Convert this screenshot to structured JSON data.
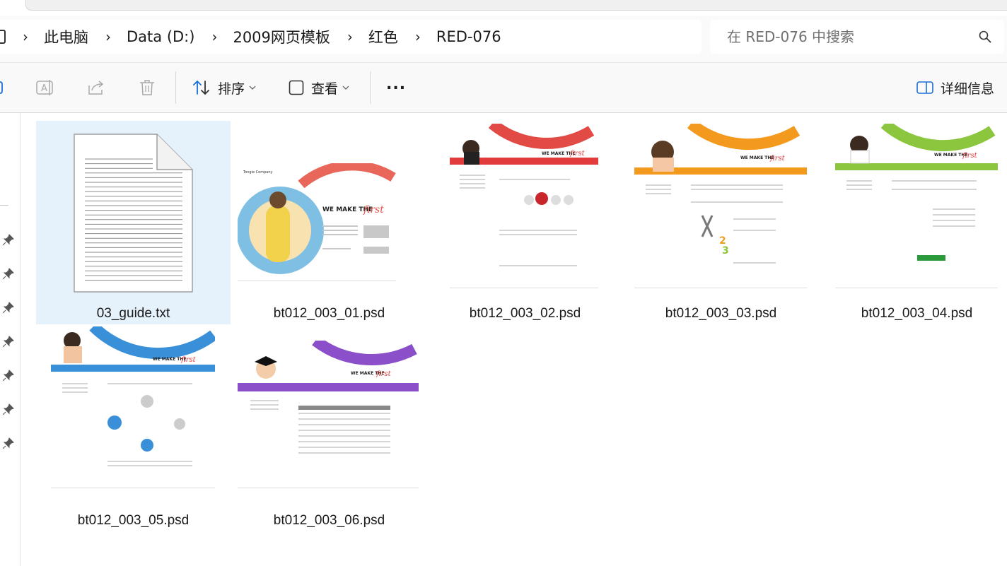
{
  "address_bar": {
    "breadcrumbs": [
      "此电脑",
      "Data (D:)",
      "2009网页模板",
      "红色",
      "RED-076"
    ]
  },
  "search": {
    "placeholder": "在 RED-076 中搜索"
  },
  "toolbar": {
    "sort_label": "排序",
    "view_label": "查看",
    "more_label": "...",
    "details_label": "详细信息"
  },
  "files": [
    {
      "name": "03_guide.txt",
      "type": "text",
      "selected": true
    },
    {
      "name": "bt012_003_01.psd",
      "type": "psd",
      "accent": "#e8534a"
    },
    {
      "name": "bt012_003_02.psd",
      "type": "psd",
      "accent": "#e23b3b"
    },
    {
      "name": "bt012_003_03.psd",
      "type": "psd",
      "accent": "#f39a1e"
    },
    {
      "name": "bt012_003_04.psd",
      "type": "psd",
      "accent": "#8cc63e"
    },
    {
      "name": "bt012_003_05.psd",
      "type": "psd",
      "accent": "#3a8fd9"
    },
    {
      "name": "bt012_003_06.psd",
      "type": "psd",
      "accent": "#8a4fc9"
    }
  ],
  "thumbnail_text": {
    "slogan": "WE MAKE THE",
    "slogan_script": "first",
    "company": "Tongie Company"
  }
}
